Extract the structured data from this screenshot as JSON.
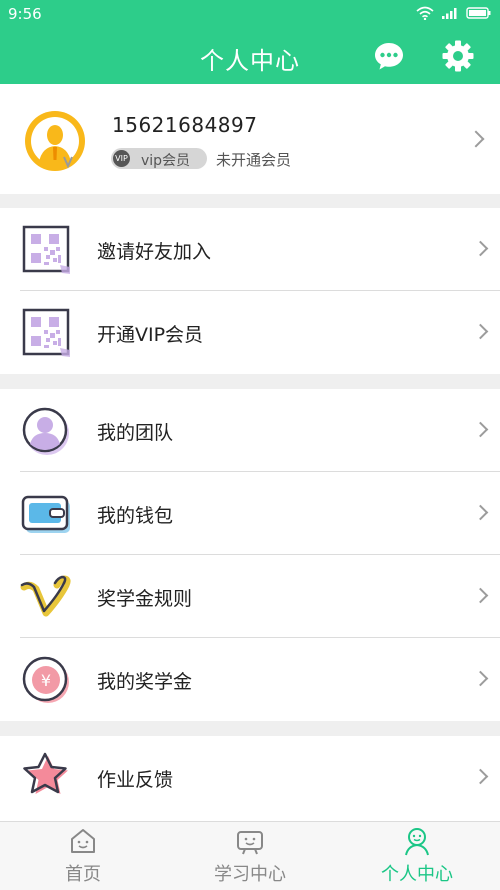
{
  "status_bar": {
    "time": "9:56",
    "icons": [
      "wifi-icon",
      "signal-icon",
      "battery-icon"
    ]
  },
  "header": {
    "title": "个人中心",
    "icons": [
      "chat-icon",
      "gear-icon"
    ]
  },
  "profile": {
    "phone": "15621684897",
    "vip_badge_icon": "VIP",
    "vip_badge_label": "vip会员",
    "vip_status": "未开通会员"
  },
  "menu": {
    "group1": [
      {
        "label": "邀请好友加入",
        "icon": "qr-code-icon"
      },
      {
        "label": "开通VIP会员",
        "icon": "qr-code-icon"
      }
    ],
    "group2": [
      {
        "label": "我的团队",
        "icon": "team-icon"
      },
      {
        "label": "我的钱包",
        "icon": "wallet-icon"
      },
      {
        "label": "奖学金规则",
        "icon": "v-rules-icon"
      },
      {
        "label": "我的奖学金",
        "icon": "yen-coin-icon"
      }
    ],
    "group3": [
      {
        "label": "作业反馈",
        "icon": "star-icon"
      }
    ]
  },
  "tab_bar": {
    "tabs": [
      {
        "label": "首页",
        "icon": "home-icon"
      },
      {
        "label": "学习中心",
        "icon": "study-icon"
      },
      {
        "label": "个人中心",
        "icon": "profile-icon",
        "active": true
      }
    ]
  },
  "colors": {
    "brand": "#2dcd8a",
    "active_tab": "#1bc686",
    "background": "#efefef"
  }
}
